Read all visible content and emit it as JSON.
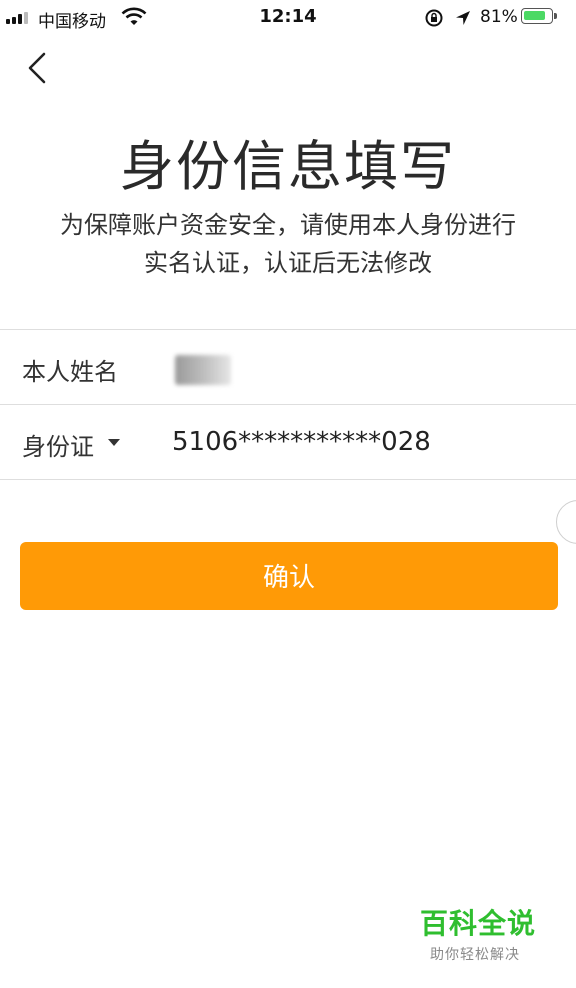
{
  "status_bar": {
    "carrier": "中国移动",
    "time": "12:14",
    "battery": "81%",
    "battery_level": 0.81,
    "icons": [
      "signal-icon",
      "wifi-icon",
      "rotation-lock-icon",
      "location-icon",
      "battery-icon"
    ]
  },
  "nav": {
    "back_icon": "chevron-left-icon"
  },
  "header": {
    "title": "身份信息填写",
    "subtitle_line1": "为保障账户资金安全，请使用本人身份进行",
    "subtitle_line2": "实名认证，认证后无法修改"
  },
  "form": {
    "name_label": "本人姓名",
    "name_value": "",
    "id_type_label": "身份证",
    "id_number": "5106***********028"
  },
  "actions": {
    "confirm_label": "确认"
  },
  "watermark": {
    "title": "百科全说",
    "subtitle": "助你轻松解决"
  },
  "colors": {
    "accent": "#ff9a06",
    "watermark_green": "#2fbe2f",
    "battery_green": "#4cd964"
  }
}
